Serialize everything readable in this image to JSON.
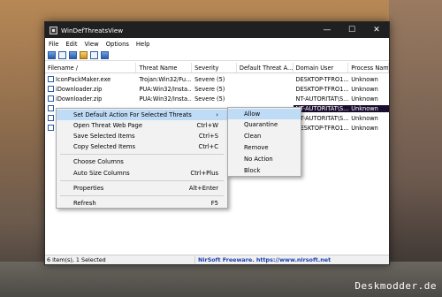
{
  "window": {
    "title": "WinDefThreatsView"
  },
  "window_controls": {
    "minimize": "—",
    "maximize": "☐",
    "close": "✕"
  },
  "menu": [
    "File",
    "Edit",
    "View",
    "Options",
    "Help"
  ],
  "toolbar_icons": [
    "save-icon",
    "copy-icon",
    "report-icon",
    "properties-icon",
    "search-icon",
    "exit-icon"
  ],
  "columns": [
    "Filename",
    "Threat Name",
    "Severity",
    "Default Threat A...",
    "Domain User",
    "Process Nam"
  ],
  "sort_indicator": "/",
  "rows": [
    {
      "filename": "IconPackMaker.exe",
      "threat": "Trojan:Win32/Fu...",
      "severity": "Severe (5)",
      "action": "",
      "user": "DESKTOP-TFRO1...",
      "process": "Unknown"
    },
    {
      "filename": "iDownloader.zip",
      "threat": "PUA:Win32/Insta...",
      "severity": "Severe (5)",
      "action": "",
      "user": "DESKTOP-TFRO1...",
      "process": "Unknown"
    },
    {
      "filename": "iDownloader.zip",
      "threat": "PUA:Win32/Insta...",
      "severity": "Severe (5)",
      "action": "",
      "user": "NT-AUTORITÄT\\S...",
      "process": "Unknown"
    },
    {
      "filename": "",
      "threat": "",
      "severity": "",
      "action": "",
      "user": "NT-AUTORITÄT\\S...",
      "process": "Unknown",
      "selected": true
    },
    {
      "filename": "",
      "threat": "",
      "severity": "",
      "action": "",
      "user": "NT-AUTORITÄT\\S...",
      "process": "Unknown"
    },
    {
      "filename": "",
      "threat": "",
      "severity": "",
      "action": "",
      "user": "DESKTOP-TFRO1...",
      "process": "Unknown"
    }
  ],
  "context_menu": [
    {
      "label": "Set Default Action For Selected Threats",
      "shortcut": "›",
      "highlighted": true
    },
    {
      "label": "Open Threat Web Page",
      "shortcut": "Ctrl+W"
    },
    {
      "label": "Save Selected Items",
      "shortcut": "Ctrl+S"
    },
    {
      "label": "Copy Selected Items",
      "shortcut": "Ctrl+C"
    },
    {
      "label": "Choose Columns",
      "shortcut": ""
    },
    {
      "label": "Auto Size Columns",
      "shortcut": "Ctrl+Plus"
    },
    {
      "label": "Properties",
      "shortcut": "Alt+Enter"
    },
    {
      "label": "Refresh",
      "shortcut": "F5"
    }
  ],
  "submenu": [
    "Allow",
    "Quarantine",
    "Clean",
    "Remove",
    "No Action",
    "Block"
  ],
  "status": {
    "left": "6 item(s), 1 Selected",
    "right": "NirSoft Freeware. https://www.nirsoft.net"
  },
  "watermark": "Deskmodder.de",
  "colors": {
    "titlebar": "#202020",
    "selection": "#1a0d2e",
    "menu_highlight": "#bfdcf7",
    "status_link": "#1b3fb0"
  }
}
